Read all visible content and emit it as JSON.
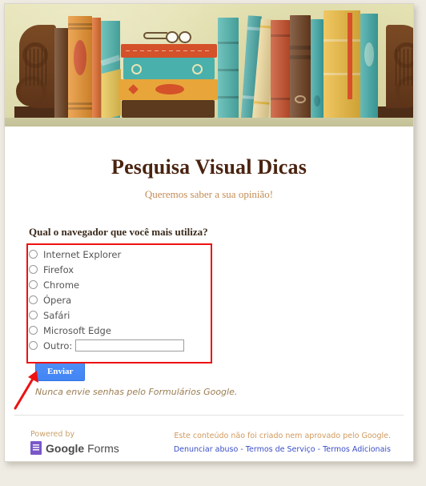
{
  "form": {
    "title": "Pesquisa Visual Dicas",
    "subtitle": "Queremos saber a sua opinião!",
    "question": "Qual o navegador que você mais utiliza?",
    "options": [
      {
        "label": "Internet Explorer",
        "has_input": false
      },
      {
        "label": "Firefox",
        "has_input": false
      },
      {
        "label": "Chrome",
        "has_input": false
      },
      {
        "label": "Ópera",
        "has_input": false
      },
      {
        "label": "Safári",
        "has_input": false
      },
      {
        "label": "Microsoft Edge",
        "has_input": false
      },
      {
        "label": "Outro:",
        "has_input": true
      }
    ],
    "other_value": "",
    "other_placeholder": "",
    "submit_label": "Enviar",
    "password_warning": "Nunca envie senhas pelo Formulários Google."
  },
  "footer": {
    "powered_by": "Powered by",
    "brand_bold": "Google",
    "brand_light": "Forms",
    "disclaimer": "Este conteúdo não foi criado nem aprovado pelo Google.",
    "link_report": "Denunciar abuso",
    "link_terms": "Termos de Serviço",
    "link_additional": "Termos Adicionais",
    "separator": "-"
  },
  "annotations": {
    "highlight_color": "#ee1111",
    "arrow_color": "#ee1111"
  },
  "theme": {
    "title_color": "#4a2310",
    "subtitle_color": "#c38d55",
    "submit_color": "#4285f4",
    "link_color": "#3b4ec6",
    "banner_bg": "#e2e0b0"
  }
}
